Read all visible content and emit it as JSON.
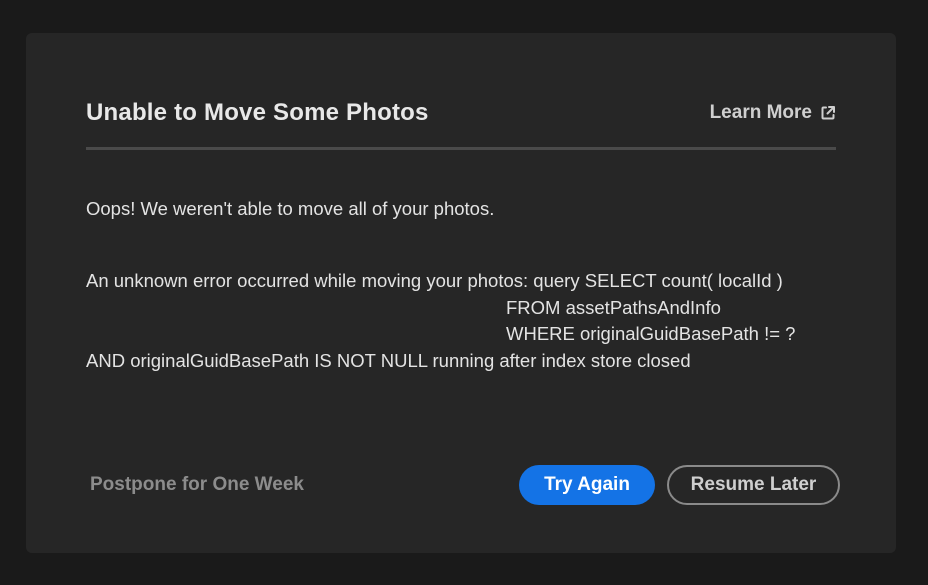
{
  "dialog": {
    "title": "Unable to Move Some Photos",
    "learn_more_label": "Learn More",
    "learn_more_icon": "external-link-icon",
    "message_primary": "Oops! We weren't able to move all of your photos.",
    "error_lines": [
      "An unknown error occurred while moving your photos: query SELECT count( localId )",
      "FROM assetPathsAndInfo",
      "WHERE originalGuidBasePath != ?",
      "AND originalGuidBasePath IS NOT NULL running after index store closed"
    ],
    "postpone_label": "Postpone for One Week",
    "try_again_label": "Try Again",
    "resume_later_label": "Resume Later"
  },
  "colors": {
    "accent": "#1473e6",
    "background": "#1a1a1a",
    "dialog_background": "#262626"
  }
}
